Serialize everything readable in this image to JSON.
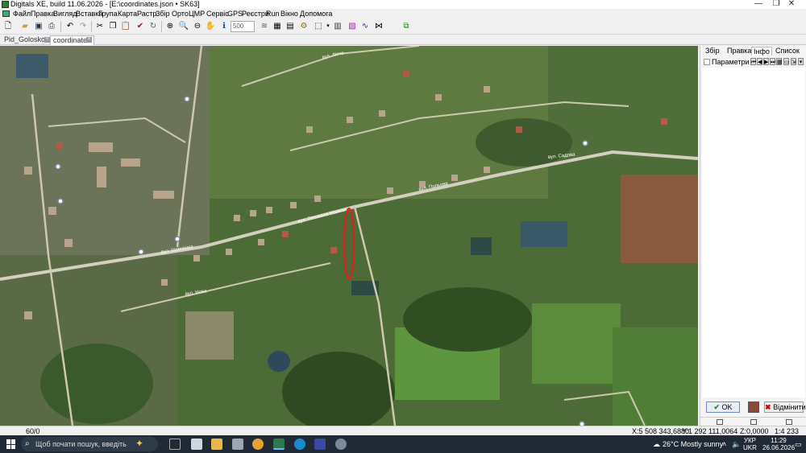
{
  "window": {
    "title": "Digitals XE, build 11.06.2026 - [E:\\coordinates.json • SK63]",
    "minimize": "—",
    "maximize": "❐",
    "close": "✕"
  },
  "menu": [
    "Файл",
    "Правка",
    "Вигляд",
    "Вставка",
    "Група",
    "Карта",
    "Растр",
    "Збір",
    "Орто",
    "ЦМР",
    "Сервіс",
    "GPS",
    "Реєстри",
    "Run",
    "Вікно",
    "Допомога"
  ],
  "toolbar": {
    "scale_value": "500"
  },
  "doc_tabs": [
    "Pid_Goloskom",
    "coordinates"
  ],
  "map": {
    "street_labels": [
      "вул. Гетьмана Мазепи",
      "вул. Шевченка",
      "вул. Польова",
      "вул. Садова",
      "вул. Лісна",
      "вул. Нова"
    ]
  },
  "panel": {
    "tabs": [
      "Збір",
      "Правка",
      "Інфо",
      "Список"
    ],
    "active_tab": "Інфо",
    "tree_item": "Параметри",
    "ok_label": "OK",
    "cancel_label": "Відмінити"
  },
  "status": {
    "count": "60/0",
    "x_coord": "X:5 508 343,6880",
    "y_coord": "Y:1 292 111,0064",
    "z_coord": "Z:0,0000",
    "scale": "1:4 233"
  },
  "taskbar": {
    "search_placeholder": "Щоб почати пошук, введіть",
    "weather": "26°C  Mostly sunny",
    "lang_top": "УКР",
    "lang_bottom": "UKR",
    "time": "11:29",
    "date": "26.06.2026"
  },
  "colors": {
    "selection_outline": "#e02020",
    "taskbar_bg": "#1f2a36"
  }
}
